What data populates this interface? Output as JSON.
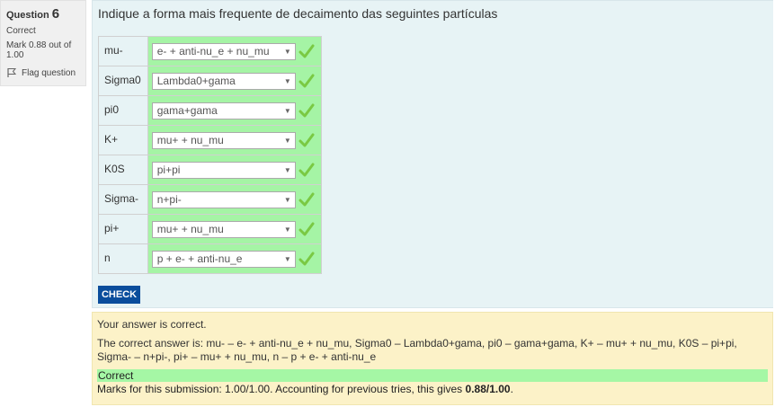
{
  "info": {
    "question_label": "Question",
    "question_number": "6",
    "state": "Correct",
    "grade": "Mark 0.88 out of 1.00",
    "flag_label": "Flag question"
  },
  "question": {
    "text": "Indique a forma mais frequente de decaimento das seguintes partículas",
    "rows": [
      {
        "label": "mu-",
        "selected": "e- + anti-nu_e + nu_mu"
      },
      {
        "label": "Sigma0",
        "selected": "Lambda0+gama"
      },
      {
        "label": "pi0",
        "selected": "gama+gama"
      },
      {
        "label": "K+",
        "selected": "mu+ + nu_mu"
      },
      {
        "label": "K0S",
        "selected": "pi+pi"
      },
      {
        "label": "Sigma-",
        "selected": "n+pi-"
      },
      {
        "label": "pi+",
        "selected": "mu+ + nu_mu"
      },
      {
        "label": "n",
        "selected": "p + e- + anti-nu_e"
      }
    ],
    "check_label": "CHECK"
  },
  "outcome": {
    "feedback": "Your answer is correct.",
    "right_answer": "The correct answer is: mu- – e- + anti-nu_e + nu_mu, Sigma0 – Lambda0+gama, pi0 – gama+gama, K+ – mu+ + nu_mu, K0S – pi+pi, Sigma- – n+pi-, pi+ – mu+ + nu_mu, n – p + e- + anti-nu_e",
    "correct_label": "Correct",
    "marks_prefix": "Marks for this submission: 1.00/1.00. Accounting for previous tries, this gives ",
    "marks_value": "0.88/1.00",
    "marks_suffix": "."
  },
  "colors": {
    "correct_green": "#a5f4a5",
    "check_button": "#0a4d9c",
    "formulation_bg": "#e7f3f5",
    "outcome_bg": "#fcf2c8",
    "tick": "#7ac943"
  },
  "icons": {
    "flag": "flag-icon",
    "tick": "checkmark-icon",
    "dropdown": "dropdown-arrow-icon"
  }
}
